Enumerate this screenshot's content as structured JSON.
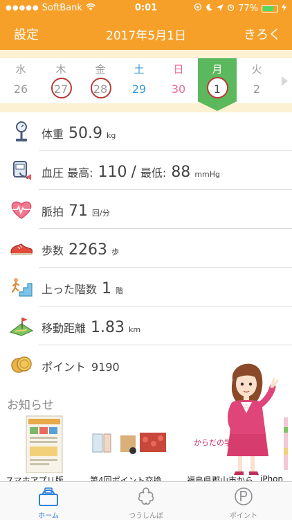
{
  "status_bar": {
    "signal": "●●●●●",
    "carrier": "SoftBank",
    "time": "0:01",
    "battery_text": "77%",
    "battery_level": 0.77
  },
  "nav": {
    "left_label": "設定",
    "title": "2017年5月1日",
    "right_label": "きろく"
  },
  "calendar": {
    "days": [
      {
        "dow": "水",
        "num": "26",
        "color": "#9a9a9a",
        "marked": false,
        "selected": false
      },
      {
        "dow": "木",
        "num": "27",
        "color": "#9a9a9a",
        "marked": true,
        "selected": false
      },
      {
        "dow": "金",
        "num": "28",
        "color": "#9a9a9a",
        "marked": true,
        "selected": false
      },
      {
        "dow": "土",
        "num": "29",
        "color": "#3a9ad9",
        "marked": false,
        "selected": false
      },
      {
        "dow": "日",
        "num": "30",
        "color": "#e86a95",
        "marked": false,
        "selected": false
      },
      {
        "dow": "月",
        "num": "1",
        "color": "#ffffff",
        "marked": true,
        "selected": true
      },
      {
        "dow": "火",
        "num": "2",
        "color": "#9a9a9a",
        "marked": false,
        "selected": false
      }
    ],
    "selected_color": "#5cb85c",
    "ring_color": "#b73a3a"
  },
  "metrics": {
    "weight": {
      "label": "体重",
      "value": "50.9",
      "unit": "kg",
      "icon": "scale-icon"
    },
    "blood_pressure": {
      "label": "血圧 最高:",
      "value_high": "110",
      "sep": "/",
      "label_low": "最低:",
      "value_low": "88",
      "unit": "mmHg",
      "icon": "blood-pressure-monitor-icon"
    },
    "pulse": {
      "label": "脈拍",
      "value": "71",
      "unit": "回/分",
      "icon": "heart-pulse-icon"
    },
    "steps": {
      "label": "歩数",
      "value": "2263",
      "unit": "歩",
      "icon": "sneaker-icon"
    },
    "floors": {
      "label": "上った階数",
      "value": "1",
      "unit": "階",
      "icon": "stairs-icon"
    },
    "distance": {
      "label": "移動距離",
      "value": "1.83",
      "unit": "km",
      "icon": "map-flag-icon"
    },
    "points": {
      "label": "ポイント",
      "value": "9190",
      "icon": "coin-icon"
    }
  },
  "news": {
    "title": "お知らせ",
    "items": [
      {
        "caption": "スマホアプリ版",
        "thumb_text": ""
      },
      {
        "caption": "第4回ポイント交換",
        "thumb_text": ""
      },
      {
        "caption": "福島県郡山市から",
        "thumb_text": "からだの学校"
      },
      {
        "caption": "iPhon",
        "thumb_text": ""
      }
    ]
  },
  "tabs": [
    {
      "label": "ホーム",
      "icon": "home-scale-icon",
      "active": true
    },
    {
      "label": "つうしんぼ",
      "icon": "flower-icon",
      "active": false
    },
    {
      "label": "ポイント",
      "icon": "point-coin-icon",
      "active": false
    }
  ],
  "colors": {
    "header": "#f6a02a",
    "accent_green": "#5cb85c",
    "tab_active": "#2f7fd8"
  }
}
